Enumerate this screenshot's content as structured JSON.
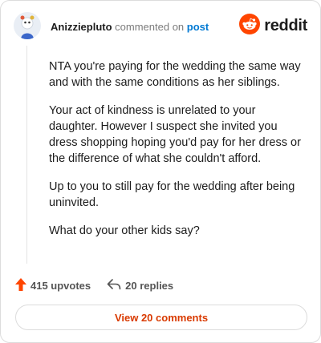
{
  "header": {
    "username": "Anizziepluto",
    "verb": "commented on",
    "link_text": "post",
    "logo_text": "reddit"
  },
  "comment": {
    "paragraphs": [
      "NTA you're paying for the wedding the same way and with the same conditions as her siblings.",
      "Your act of kindness is unrelated to your daughter. However I suspect she invited you dress shopping hoping you'd pay for her dress or the difference of what she couldn't afford.",
      "Up to you to still pay for the wedding after being uninvited.",
      "What do your other kids say?"
    ]
  },
  "actions": {
    "upvotes": "415 upvotes",
    "replies": "20 replies"
  },
  "footer": {
    "view_button": "View 20 comments"
  },
  "colors": {
    "brand": "#ff4500",
    "link": "#0079d3",
    "button_text": "#d93a00"
  },
  "icons": [
    "avatar",
    "reddit-logo-icon",
    "upvote-icon",
    "reply-icon"
  ]
}
